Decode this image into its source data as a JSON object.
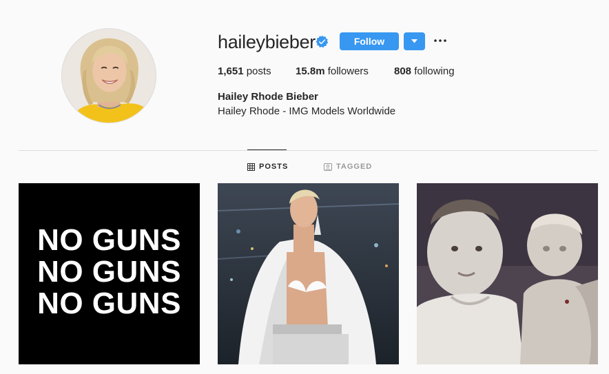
{
  "profile": {
    "username": "haileybieber",
    "verified": true,
    "follow_label": "Follow",
    "stats": {
      "posts_count": "1,651",
      "posts_label": "posts",
      "followers_count": "15.8m",
      "followers_label": "followers",
      "following_count": "808",
      "following_label": "following"
    },
    "full_name": "Hailey Rhode Bieber",
    "bio": "Hailey Rhode - IMG Models Worldwide"
  },
  "tabs": [
    {
      "label": "POSTS",
      "icon": "grid-icon",
      "active": true
    },
    {
      "label": "TAGGED",
      "icon": "tag-icon",
      "active": false
    }
  ],
  "posts": [
    {
      "type": "text-image",
      "lines": [
        "NO GUNS",
        "NO GUNS",
        "NO GUNS"
      ]
    },
    {
      "type": "photo"
    },
    {
      "type": "photo"
    }
  ],
  "colors": {
    "accent": "#3897f0",
    "background": "#fafafa",
    "text": "#262626",
    "muted": "#999999",
    "divider": "#dbdbdb"
  }
}
